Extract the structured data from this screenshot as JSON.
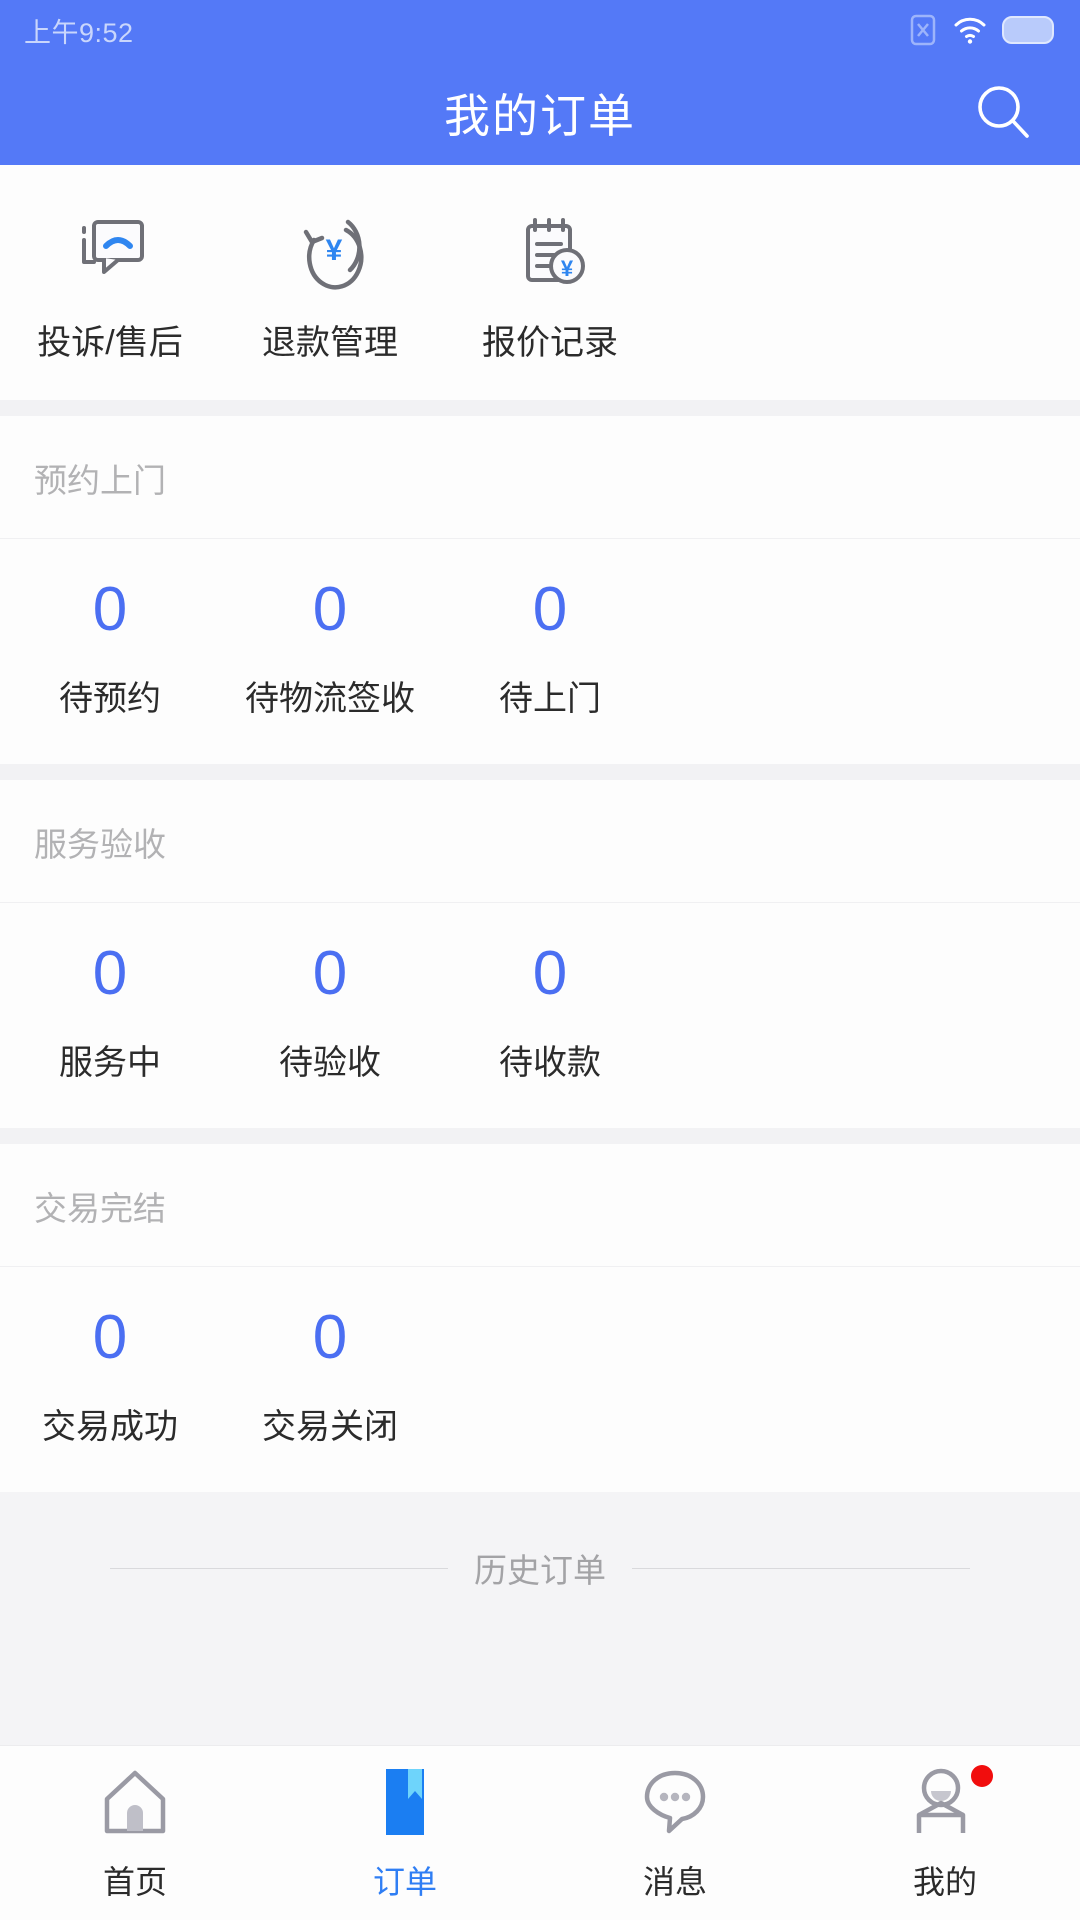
{
  "colors": {
    "brand_blue": "#5479f7",
    "count_blue": "#4b6ff2",
    "tab_active_blue": "#2f7ef4",
    "badge_red": "#f10d0d",
    "icon_gray": "#8c8c96",
    "icon_accent": "#2f86f0",
    "page_bg": "#f4f4f6",
    "card_bg": "#fdfdfd",
    "muted_text": "#b2b2b4"
  },
  "statusbar": {
    "time": "上午9:52",
    "icons": [
      "sim-no-service-icon",
      "wifi-icon",
      "battery-icon"
    ]
  },
  "header": {
    "title": "我的订单",
    "search_icon": "search-icon"
  },
  "quick_actions": [
    {
      "label": "投诉/售后",
      "icon": "complaint-aftersale-icon"
    },
    {
      "label": "退款管理",
      "icon": "refund-management-icon"
    },
    {
      "label": "报价记录",
      "icon": "quotation-record-icon"
    }
  ],
  "sections": [
    {
      "title": "预约上门",
      "stats": [
        {
          "label": "待预约",
          "count": "0"
        },
        {
          "label": "待物流签收",
          "count": "0"
        },
        {
          "label": "待上门",
          "count": "0"
        }
      ]
    },
    {
      "title": "服务验收",
      "stats": [
        {
          "label": "服务中",
          "count": "0"
        },
        {
          "label": "待验收",
          "count": "0"
        },
        {
          "label": "待收款",
          "count": "0"
        }
      ]
    },
    {
      "title": "交易完结",
      "stats": [
        {
          "label": "交易成功",
          "count": "0"
        },
        {
          "label": "交易关闭",
          "count": "0"
        }
      ]
    }
  ],
  "history": {
    "text": "历史订单"
  },
  "tabbar": [
    {
      "label": "首页",
      "icon": "home-icon",
      "active": false,
      "badge": false
    },
    {
      "label": "订单",
      "icon": "order-book-icon",
      "active": true,
      "badge": false
    },
    {
      "label": "消息",
      "icon": "message-bubble-icon",
      "active": false,
      "badge": false
    },
    {
      "label": "我的",
      "icon": "profile-person-icon",
      "active": false,
      "badge": true
    }
  ]
}
